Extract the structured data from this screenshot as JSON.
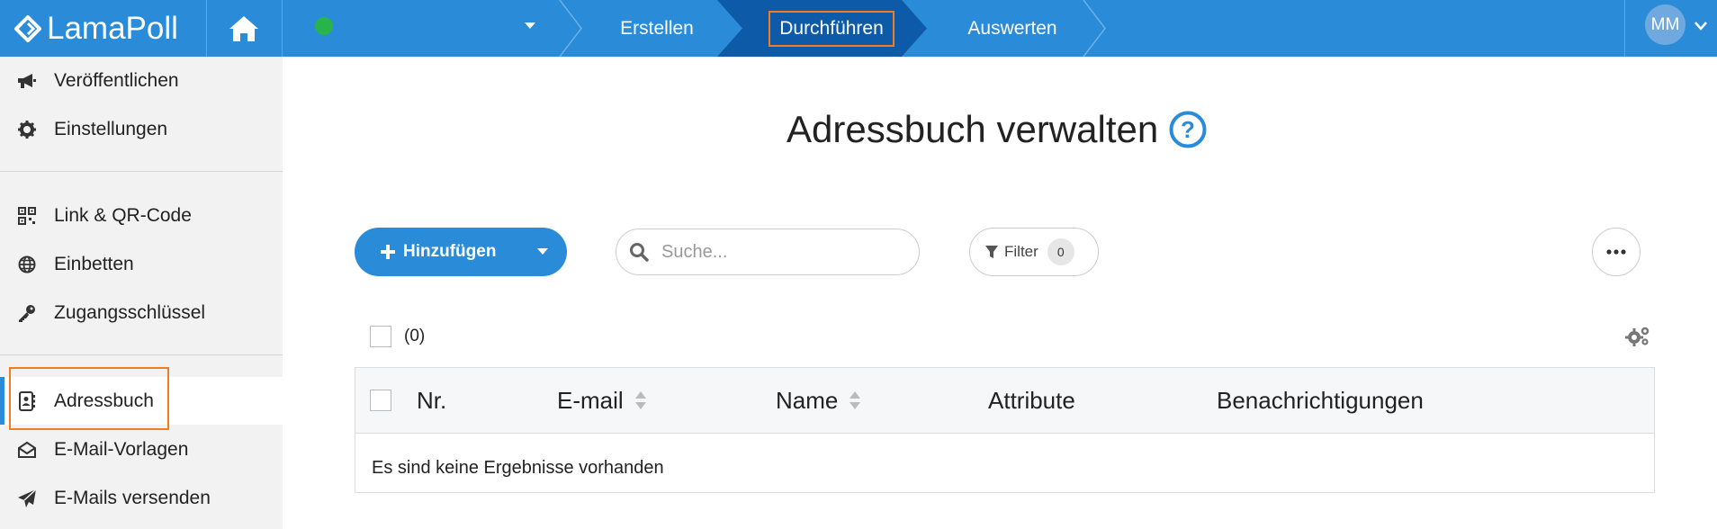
{
  "app": {
    "name": "LamaPoll"
  },
  "steps": [
    {
      "label": "Erstellen"
    },
    {
      "label": "Durchführen"
    },
    {
      "label": "Auswerten"
    }
  ],
  "user": {
    "initials": "MM"
  },
  "sidebar": {
    "items": [
      {
        "label": "Veröffentlichen",
        "icon": "megaphone-icon"
      },
      {
        "label": "Einstellungen",
        "icon": "gear-icon"
      },
      {
        "label": "Link & QR-Code",
        "icon": "qr-code-icon"
      },
      {
        "label": "Einbetten",
        "icon": "globe-icon"
      },
      {
        "label": "Zugangsschlüssel",
        "icon": "key-icon"
      },
      {
        "label": "Adressbuch",
        "icon": "address-book-icon"
      },
      {
        "label": "E-Mail-Vorlagen",
        "icon": "envelope-open-icon"
      },
      {
        "label": "E-Mails versenden",
        "icon": "paper-plane-icon"
      }
    ]
  },
  "main": {
    "title": "Adressbuch verwalten",
    "add_button": "Hinzufügen",
    "search_placeholder": "Suche...",
    "filter_label": "Filter",
    "filter_count": "0",
    "selection_count": "(0)",
    "table": {
      "columns": [
        "Nr.",
        "E-mail",
        "Name",
        "Attribute",
        "Benachrichtigungen"
      ],
      "empty_message": "Es sind keine Ergebnisse vorhanden"
    }
  },
  "colors": {
    "brand": "#2a8bd8",
    "highlight": "#f47b20",
    "status": "#28b44a"
  }
}
